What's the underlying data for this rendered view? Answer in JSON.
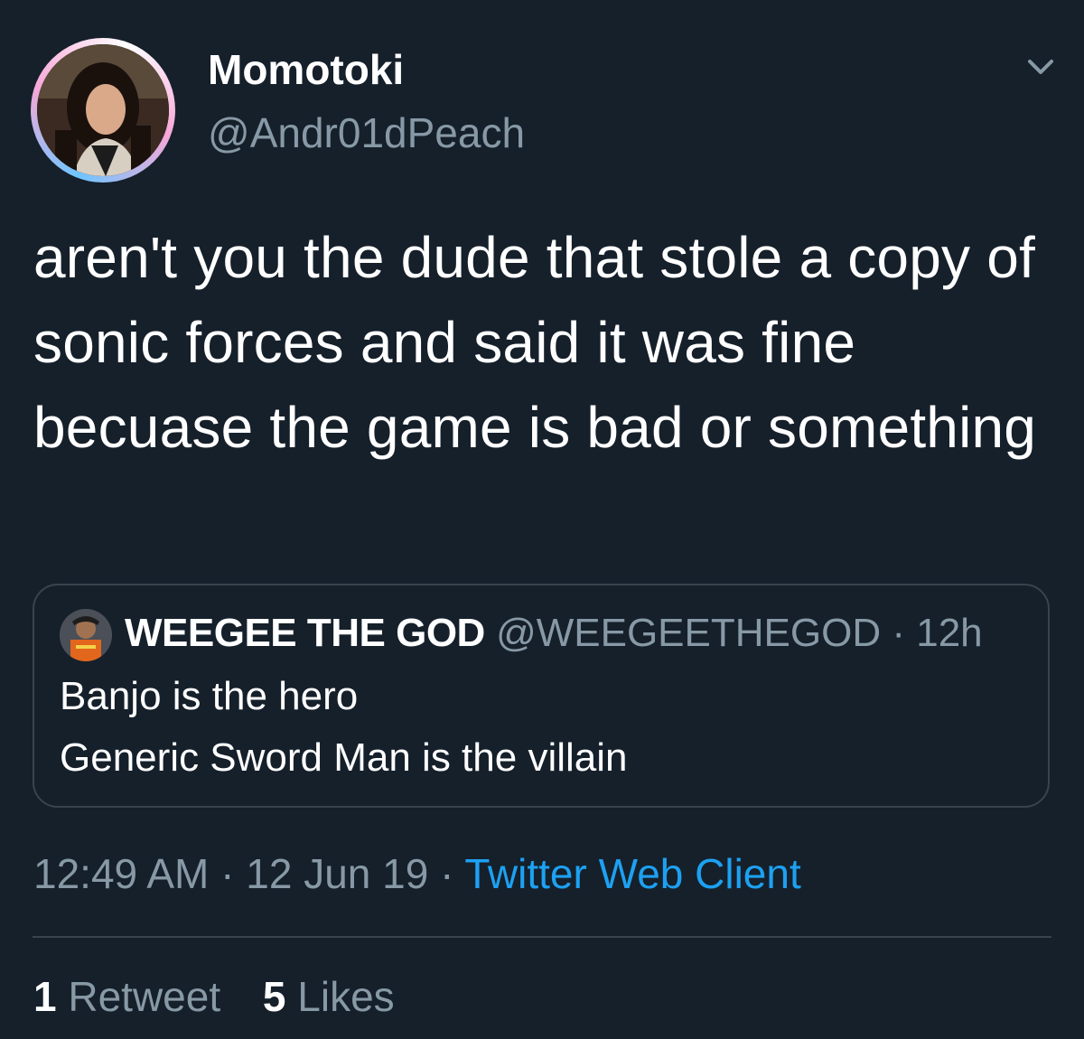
{
  "author": {
    "display_name": "Momotoki",
    "handle": "@Andr01dPeach",
    "avatar_icon": "profile-photo"
  },
  "tweet": {
    "text": "aren't you the dude that stole a copy of sonic forces and said it was fine becuase the game is bad or something"
  },
  "quoted_tweet": {
    "display_name": "WEEGEE THE GOD",
    "handle": "@WEEGEETHEGOD",
    "separator": "·",
    "time": "12h",
    "line1": "Banjo is the hero",
    "line2": "Generic Sword Man is the villain"
  },
  "meta": {
    "time": "12:49 AM",
    "sep1": "·",
    "date": "12 Jun 19",
    "sep2": "·",
    "source": "Twitter Web Client"
  },
  "stats": {
    "retweets_count": "1",
    "retweets_label": "Retweet",
    "likes_count": "5",
    "likes_label": "Likes"
  },
  "colors": {
    "background": "#15202b",
    "secondary_text": "#8899a6",
    "link": "#1da1f2",
    "border": "#38444d"
  }
}
